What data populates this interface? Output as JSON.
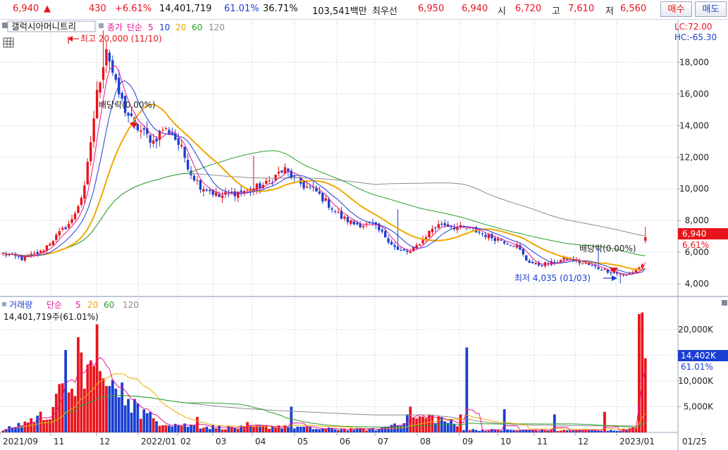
{
  "header": {
    "price": "6,940",
    "change_arrow": "▲",
    "change": "430",
    "change_pct": "+6.61%",
    "volume": "14,401,719",
    "vol_ratio": "61.01%",
    "turnover": "36.71%",
    "amount": "103,541백만",
    "bid_label": "최우선",
    "bid": "6,950",
    "ask": "6,940",
    "open_label": "시",
    "open": "6,720",
    "high_label": "고",
    "high": "7,610",
    "low_label": "저",
    "low": "6,560",
    "buy_button": "매수",
    "sell_button": "매도"
  },
  "legend": {
    "stock_name": "갤럭시아머니트리",
    "price_label": "종가",
    "ma_label": "단순",
    "ma5": "5",
    "ma10": "10",
    "ma20": "20",
    "ma60": "60",
    "ma120": "120",
    "lc": "LC:72.00",
    "hc": "HC:-65.30",
    "vol_label": "거래량",
    "vol_ma_label": "단순",
    "vol_ma5": "5",
    "vol_ma20": "20",
    "vol_ma60": "60",
    "vol_ma120": "120",
    "vol_info": "14,401,719주(61.01%)"
  },
  "annotations": {
    "high": "최고 20,000 (11/10)",
    "low": "최저 4,035 (01/03)",
    "dividend1": "배당락(0.00%)",
    "dividend2": "배당락(0.00%)"
  },
  "colors": {
    "up": "#e8141c",
    "down": "#1a3fd1",
    "ma5": "#e5178f",
    "ma10": "#1f3ad0",
    "ma20": "#f2a800",
    "ma60": "#2ca02c",
    "ma120": "#8c8c8c"
  },
  "chart_data": {
    "type": "candlestick",
    "price_axis": {
      "ticks": [
        "4,000",
        "6,000",
        "8,000",
        "10,000",
        "12,000",
        "14,000",
        "16,000",
        "18,000"
      ],
      "ylim": [
        3200,
        20600
      ]
    },
    "current_price_label": "6,940",
    "current_pct_label": "6.61%",
    "volume_axis": {
      "ticks": [
        "5,000K",
        "10,000K",
        "15,000K",
        "20,000K"
      ],
      "ylim": [
        0,
        26000
      ]
    },
    "current_volume_label": "14,402K",
    "current_volume_pct_label": "61.01%",
    "x_labels": [
      "2021/09",
      "11",
      "12",
      "2022/01",
      "02",
      "03",
      "04",
      "05",
      "06",
      "07",
      "08",
      "09",
      "10",
      "11",
      "12",
      "2023/01",
      "01/25"
    ],
    "price_anchors": [
      [
        0,
        5900
      ],
      [
        6,
        5600
      ],
      [
        12,
        6000
      ],
      [
        18,
        7200
      ],
      [
        22,
        8000
      ],
      [
        26,
        10000
      ],
      [
        28,
        13000
      ],
      [
        30,
        16000
      ],
      [
        33,
        19000
      ],
      [
        36,
        16500
      ],
      [
        39,
        15000
      ],
      [
        42,
        14000
      ],
      [
        45,
        13500
      ],
      [
        48,
        13000
      ],
      [
        51,
        13800
      ],
      [
        54,
        13500
      ],
      [
        57,
        12500
      ],
      [
        60,
        11000
      ],
      [
        63,
        10200
      ],
      [
        66,
        9900
      ],
      [
        69,
        9500
      ],
      [
        72,
        9700
      ],
      [
        78,
        9900
      ],
      [
        84,
        10300
      ],
      [
        88,
        11000
      ],
      [
        90,
        11200
      ],
      [
        93,
        10600
      ],
      [
        96,
        10200
      ],
      [
        100,
        9800
      ],
      [
        104,
        9000
      ],
      [
        108,
        8200
      ],
      [
        112,
        7800
      ],
      [
        118,
        7700
      ],
      [
        122,
        7000
      ],
      [
        126,
        6100
      ],
      [
        130,
        6000
      ],
      [
        133,
        6600
      ],
      [
        137,
        7500
      ],
      [
        140,
        7800
      ],
      [
        144,
        7600
      ],
      [
        150,
        7400
      ],
      [
        155,
        7000
      ],
      [
        160,
        6700
      ],
      [
        164,
        6400
      ],
      [
        167,
        5500
      ],
      [
        170,
        5200
      ],
      [
        175,
        5300
      ],
      [
        180,
        5600
      ],
      [
        185,
        5300
      ],
      [
        190,
        5000
      ],
      [
        195,
        4700
      ],
      [
        199,
        4500
      ],
      [
        202,
        4900
      ],
      [
        204,
        5200
      ],
      [
        205,
        6940
      ]
    ],
    "volume_anchors": [
      [
        0,
        400
      ],
      [
        14,
        3500
      ],
      [
        22,
        10000
      ],
      [
        28,
        12000
      ],
      [
        32,
        9000
      ],
      [
        38,
        7000
      ],
      [
        44,
        4000
      ],
      [
        48,
        2500
      ],
      [
        56,
        1500
      ],
      [
        65,
        1100
      ],
      [
        75,
        900
      ],
      [
        90,
        1300
      ],
      [
        100,
        700
      ],
      [
        120,
        600
      ],
      [
        128,
        2400
      ],
      [
        138,
        3000
      ],
      [
        148,
        500
      ],
      [
        175,
        400
      ],
      [
        195,
        350
      ],
      [
        204,
        900
      ],
      [
        205,
        14402
      ]
    ],
    "volume_spikes": [
      [
        17,
        7500
      ],
      [
        20,
        16000
      ],
      [
        22,
        8500
      ],
      [
        24,
        18500
      ],
      [
        26,
        8500
      ],
      [
        28,
        14000
      ],
      [
        30,
        21000
      ],
      [
        33,
        9000
      ],
      [
        36,
        8500
      ],
      [
        40,
        6500
      ],
      [
        42,
        6500
      ],
      [
        62,
        3000
      ],
      [
        78,
        2000
      ],
      [
        92,
        5000
      ],
      [
        130,
        5000
      ],
      [
        146,
        3500
      ],
      [
        148,
        16500
      ],
      [
        160,
        4500
      ],
      [
        176,
        3500
      ],
      [
        192,
        4000
      ],
      [
        200,
        800
      ],
      [
        203,
        23000
      ],
      [
        204,
        23300
      ]
    ],
    "bar_count": 206
  }
}
